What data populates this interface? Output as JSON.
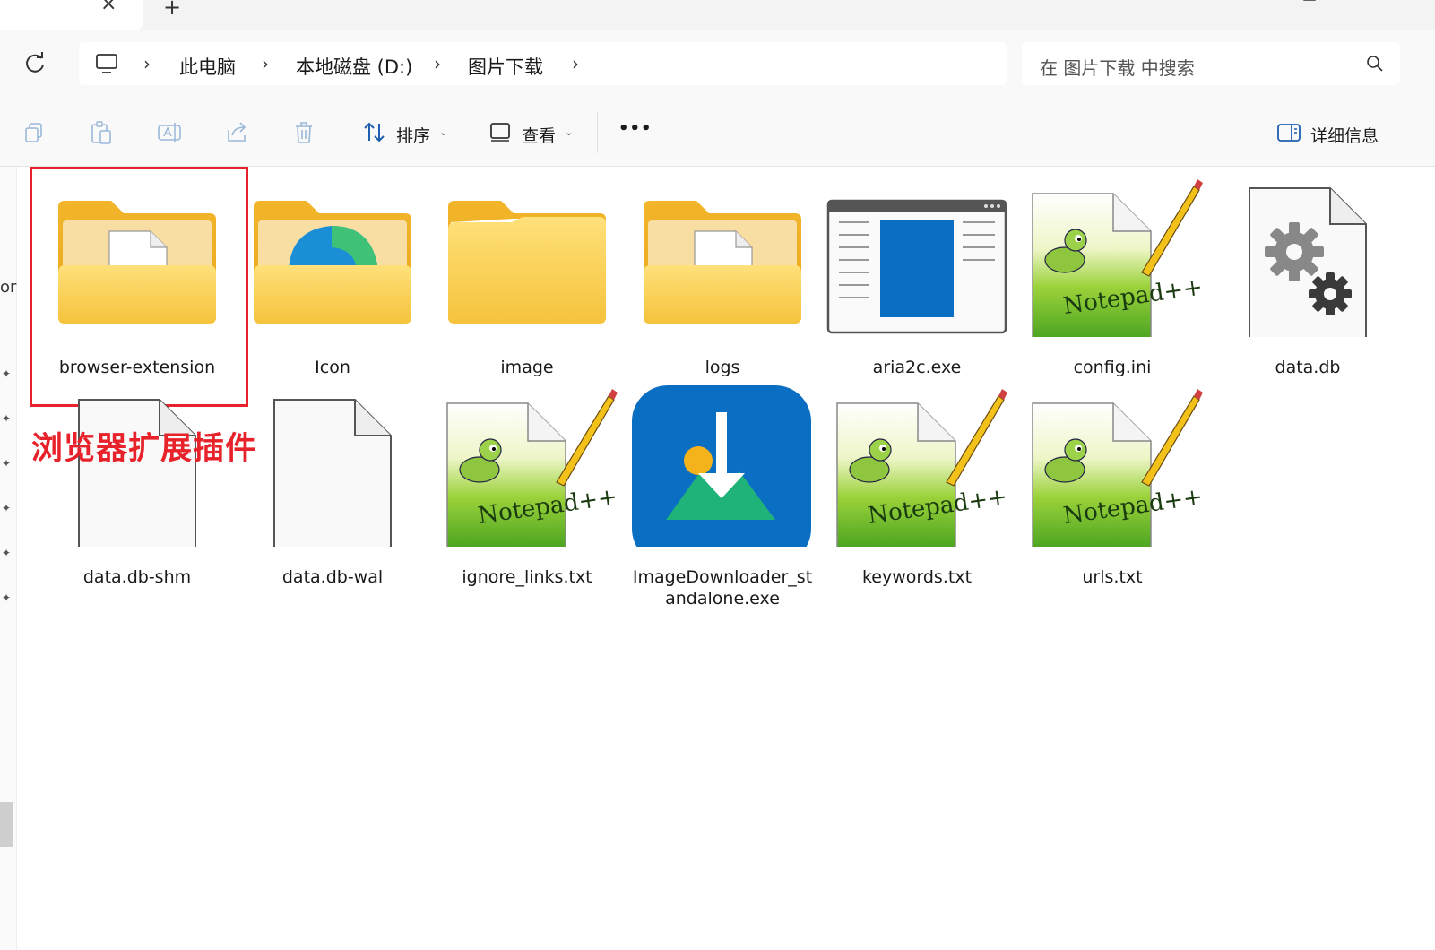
{
  "window": {
    "tab_close": "×",
    "tab_new": "+"
  },
  "nav": {
    "breadcrumb": [
      "此电脑",
      "本地磁盘 (D:)",
      "图片下载"
    ],
    "search_placeholder": "在 图片下载 中搜索"
  },
  "toolbar": {
    "sort_label": "排序",
    "view_label": "查看",
    "more_label": "•••",
    "details_label": "详细信息"
  },
  "sidebar": {
    "partial_text": "or"
  },
  "annotation": {
    "label": "浏览器扩展插件",
    "color": "#e8222a"
  },
  "items": [
    {
      "name": "browser-extension",
      "icon": "folder-file-icon"
    },
    {
      "name": "Icon",
      "icon": "folder-edge-icon"
    },
    {
      "name": "image",
      "icon": "folder-icon"
    },
    {
      "name": "logs",
      "icon": "folder-file-icon"
    },
    {
      "name": "aria2c.exe",
      "icon": "exe-app-icon"
    },
    {
      "name": "config.ini",
      "icon": "notepadpp-file-icon"
    },
    {
      "name": "data.db",
      "icon": "settings-file-icon"
    },
    {
      "name": "data.db-shm",
      "icon": "blank-file-icon"
    },
    {
      "name": "data.db-wal",
      "icon": "blank-file-icon"
    },
    {
      "name": "ignore_links.txt",
      "icon": "notepadpp-file-icon"
    },
    {
      "name": "ImageDownloader_st\nandalone.exe",
      "icon": "image-downloader-icon"
    },
    {
      "name": "keywords.txt",
      "icon": "notepadpp-file-icon"
    },
    {
      "name": "urls.txt",
      "icon": "notepadpp-file-icon"
    }
  ],
  "colors": {
    "folder": "#f5c542",
    "accent_blue": "#0a6ec2",
    "selection_red": "#e8222a"
  }
}
